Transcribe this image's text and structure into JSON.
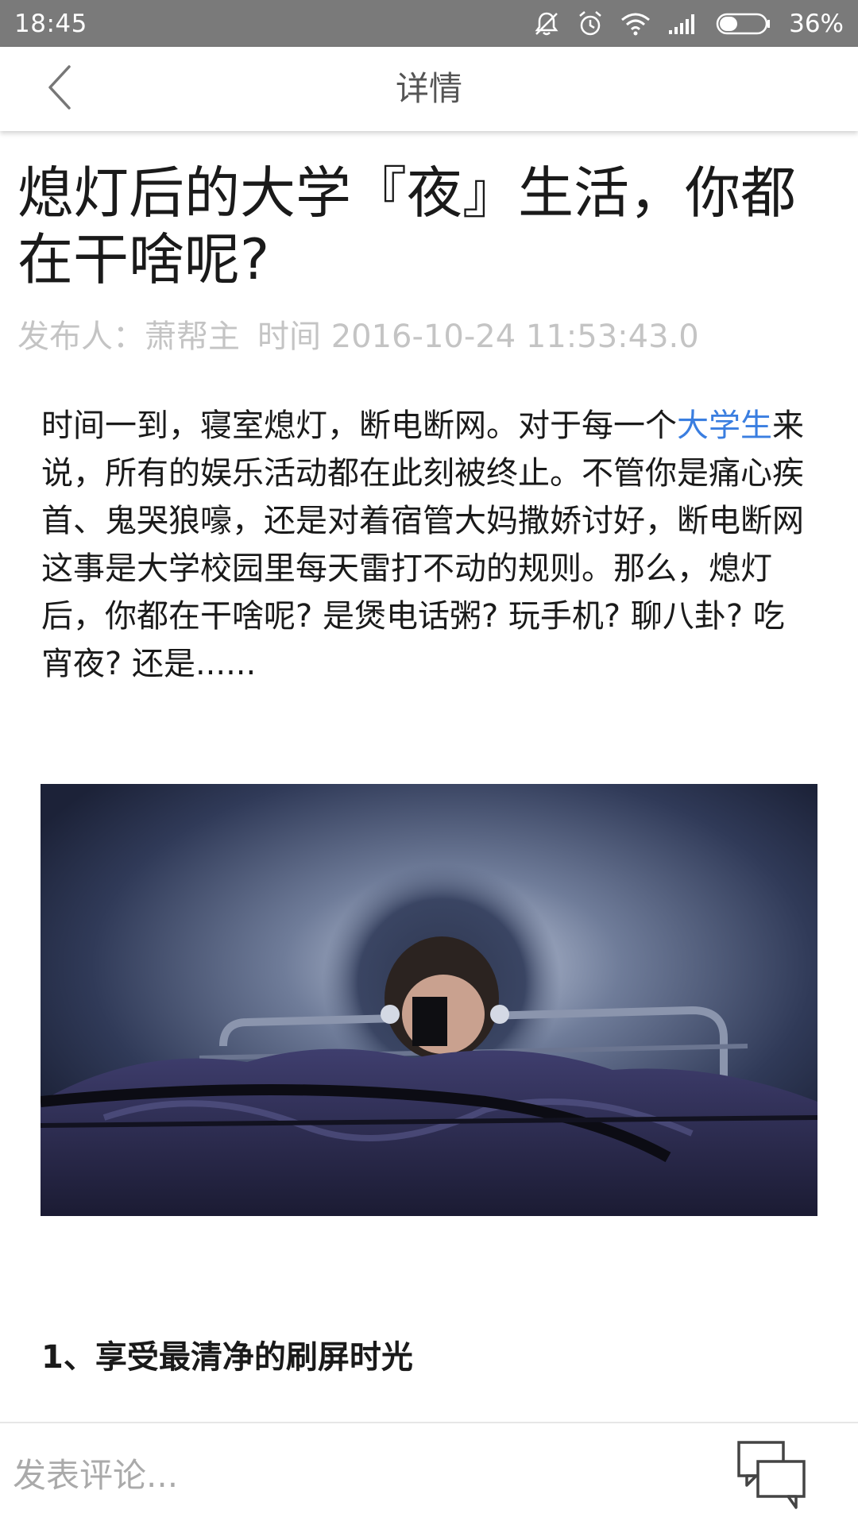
{
  "status_bar": {
    "time": "18:45",
    "battery": "36%",
    "icons": [
      "mute-icon",
      "alarm-icon",
      "wifi-icon",
      "signal-icon",
      "battery-icon"
    ]
  },
  "app_bar": {
    "back_icon": "chevron-left-icon",
    "title": "详情"
  },
  "article": {
    "title": "熄灯后的大学『夜』生活，你都在干啥呢?",
    "publisher_label": "发布人：萧帮主",
    "time_label": "时间 2016-10-24 11:53:43.0",
    "lead_before_link": "时间一到，寝室熄灯，断电断网。对于每一个",
    "lead_link": "大学生",
    "lead_after_link": "来说，所有的娱乐活动都在此刻被终止。不管你是痛心疾首、鬼哭狼嚎，还是对着宿管大妈撒娇讨好，断电断网这事是大学校园里每天雷打不动的规则。那么，熄灯后，你都在干啥呢? 是煲电话粥? 玩手机? 聊八卦? 吃宵夜? 还是......",
    "section_heading": "1、享受最清净的刷屏时光"
  },
  "comment_bar": {
    "placeholder": "发表评论...",
    "comment_icon": "comment-bubbles-icon"
  },
  "colors": {
    "status_bar_bg": "#7a7a7a",
    "link": "#3a7ee0",
    "meta_text": "#c4c4c4"
  }
}
